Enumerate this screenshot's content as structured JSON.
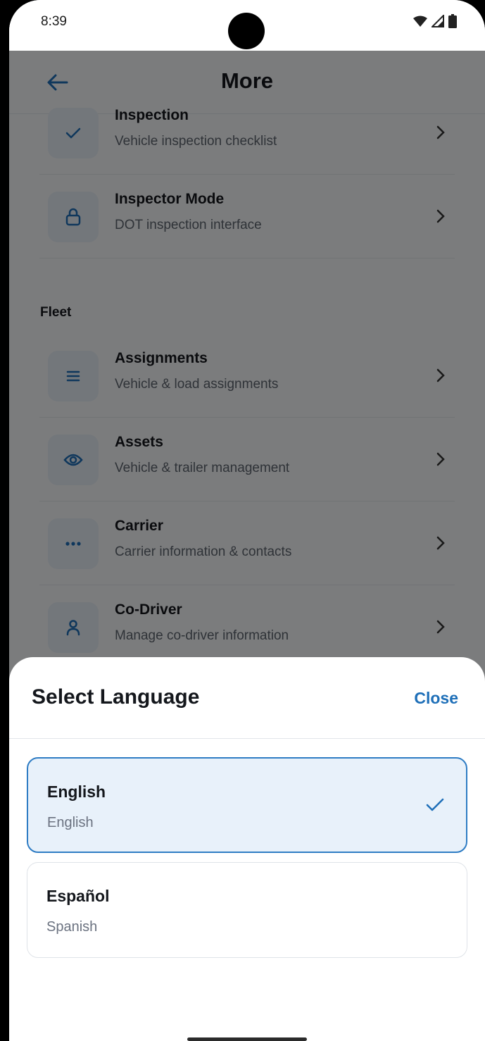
{
  "status_bar": {
    "time": "8:39"
  },
  "header": {
    "title": "More"
  },
  "menu": {
    "items": [
      {
        "title": "Inspection",
        "subtitle": "Vehicle inspection checklist",
        "icon": "check-icon"
      },
      {
        "title": "Inspector Mode",
        "subtitle": "DOT inspection interface",
        "icon": "lock-icon"
      }
    ],
    "fleet_label": "Fleet",
    "fleet_items": [
      {
        "title": "Assignments",
        "subtitle": "Vehicle & load assignments",
        "icon": "list-icon"
      },
      {
        "title": "Assets",
        "subtitle": "Vehicle & trailer management",
        "icon": "eye-icon"
      },
      {
        "title": "Carrier",
        "subtitle": "Carrier information & contacts",
        "icon": "more-dots-icon"
      },
      {
        "title": "Co-Driver",
        "subtitle": "Manage co-driver information",
        "icon": "person-icon"
      }
    ]
  },
  "language_sheet": {
    "title": "Select Language",
    "close_label": "Close",
    "options": [
      {
        "name": "English",
        "native": "English",
        "selected": true
      },
      {
        "name": "Español",
        "native": "Spanish",
        "selected": false
      }
    ]
  },
  "colors": {
    "accent": "#1e6fb8",
    "selected_bg": "#e8f1fa",
    "icon_bg": "#e6eef7"
  }
}
